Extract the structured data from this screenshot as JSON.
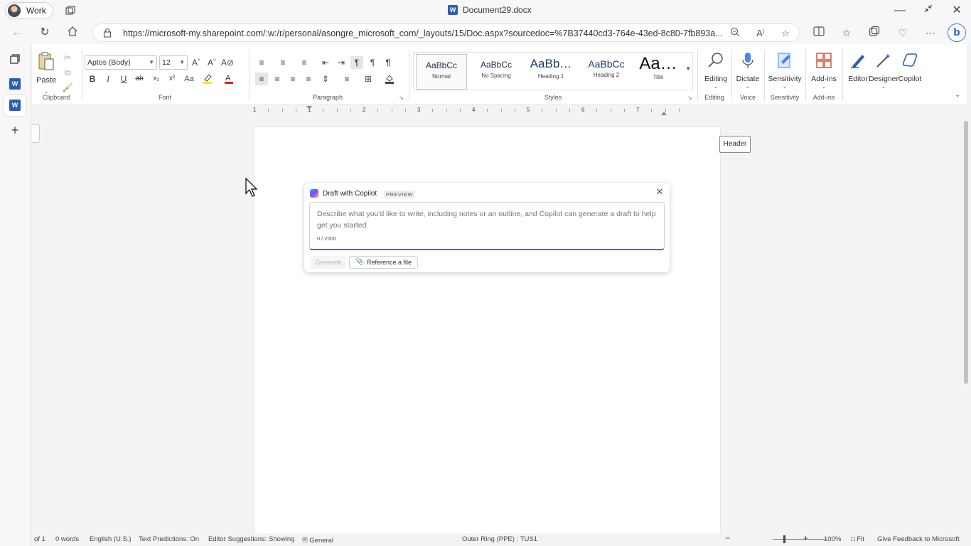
{
  "titlebar": {
    "profile_label": "Work",
    "document_title": "Document29.docx",
    "word_letter": "W"
  },
  "addressbar": {
    "url": "https://microsoft-my.sharepoint.com/:w:/r/personal/asongre_microsoft_com/_layouts/15/Doc.aspx?sourcedoc=%7B37440cd3-764e-43ed-8c80-7fb893a..."
  },
  "ribbon": {
    "clipboard": {
      "paste_label": "Paste",
      "group_label": "Clipboard"
    },
    "font": {
      "font_name": "Aptos (Body)",
      "font_size": "12",
      "group_label": "Font",
      "buttons": [
        "B",
        "I",
        "U",
        "ab",
        "x₂",
        "x²",
        "Aa"
      ]
    },
    "paragraph": {
      "group_label": "Paragraph"
    },
    "styles": {
      "group_label": "Styles",
      "items": [
        {
          "sample": "AaBbCc",
          "name": "Normal"
        },
        {
          "sample": "AaBbCc",
          "name": "No Spacing"
        },
        {
          "sample": "AaBb…",
          "name": "Heading 1"
        },
        {
          "sample": "AaBbCc",
          "name": "Heading 2"
        },
        {
          "sample": "Aa…",
          "name": "Title"
        }
      ]
    },
    "editing": {
      "label": "Editing",
      "group_label": "Editing"
    },
    "voice": {
      "label": "Dictate",
      "group_label": "Voice"
    },
    "sensitivity": {
      "label": "Sensitivity",
      "group_label": "Sensitivity"
    },
    "addins": {
      "label": "Add-ins",
      "group_label": "Add-ins"
    },
    "editor": {
      "label": "Editor"
    },
    "designer": {
      "label": "Designer"
    },
    "copilot": {
      "label": "Copilot"
    }
  },
  "ruler": {
    "numbers": [
      "1",
      "1",
      "2",
      "3",
      "4",
      "5",
      "6",
      "7"
    ]
  },
  "document": {
    "header_tag": "Header"
  },
  "copilot_draft": {
    "title": "Draft with Copilot",
    "badge": "PREVIEW",
    "placeholder": "Describe what you'd like to write, including notes or an outline, and Copilot can generate a draft to help get you started",
    "char_count": "0 / 2000",
    "generate_label": "Generate",
    "reference_label": "Reference a file"
  },
  "statusbar": {
    "page": "of 1",
    "words": "0 words",
    "language": "English (U.S.)",
    "text_predictions": "Text Predictions: On",
    "editor_suggestions": "Editor Suggestions: Showing",
    "sensitivity": "General",
    "ring": "Outer Ring (PPE) : TUS1",
    "zoom": "100%",
    "fit": "Fit",
    "feedback": "Give Feedback to Microsoft"
  },
  "colors": {
    "word_blue": "#2b5fb4",
    "accent_underline": "#5b5fc7",
    "bing_blue": "#3a7be0"
  }
}
